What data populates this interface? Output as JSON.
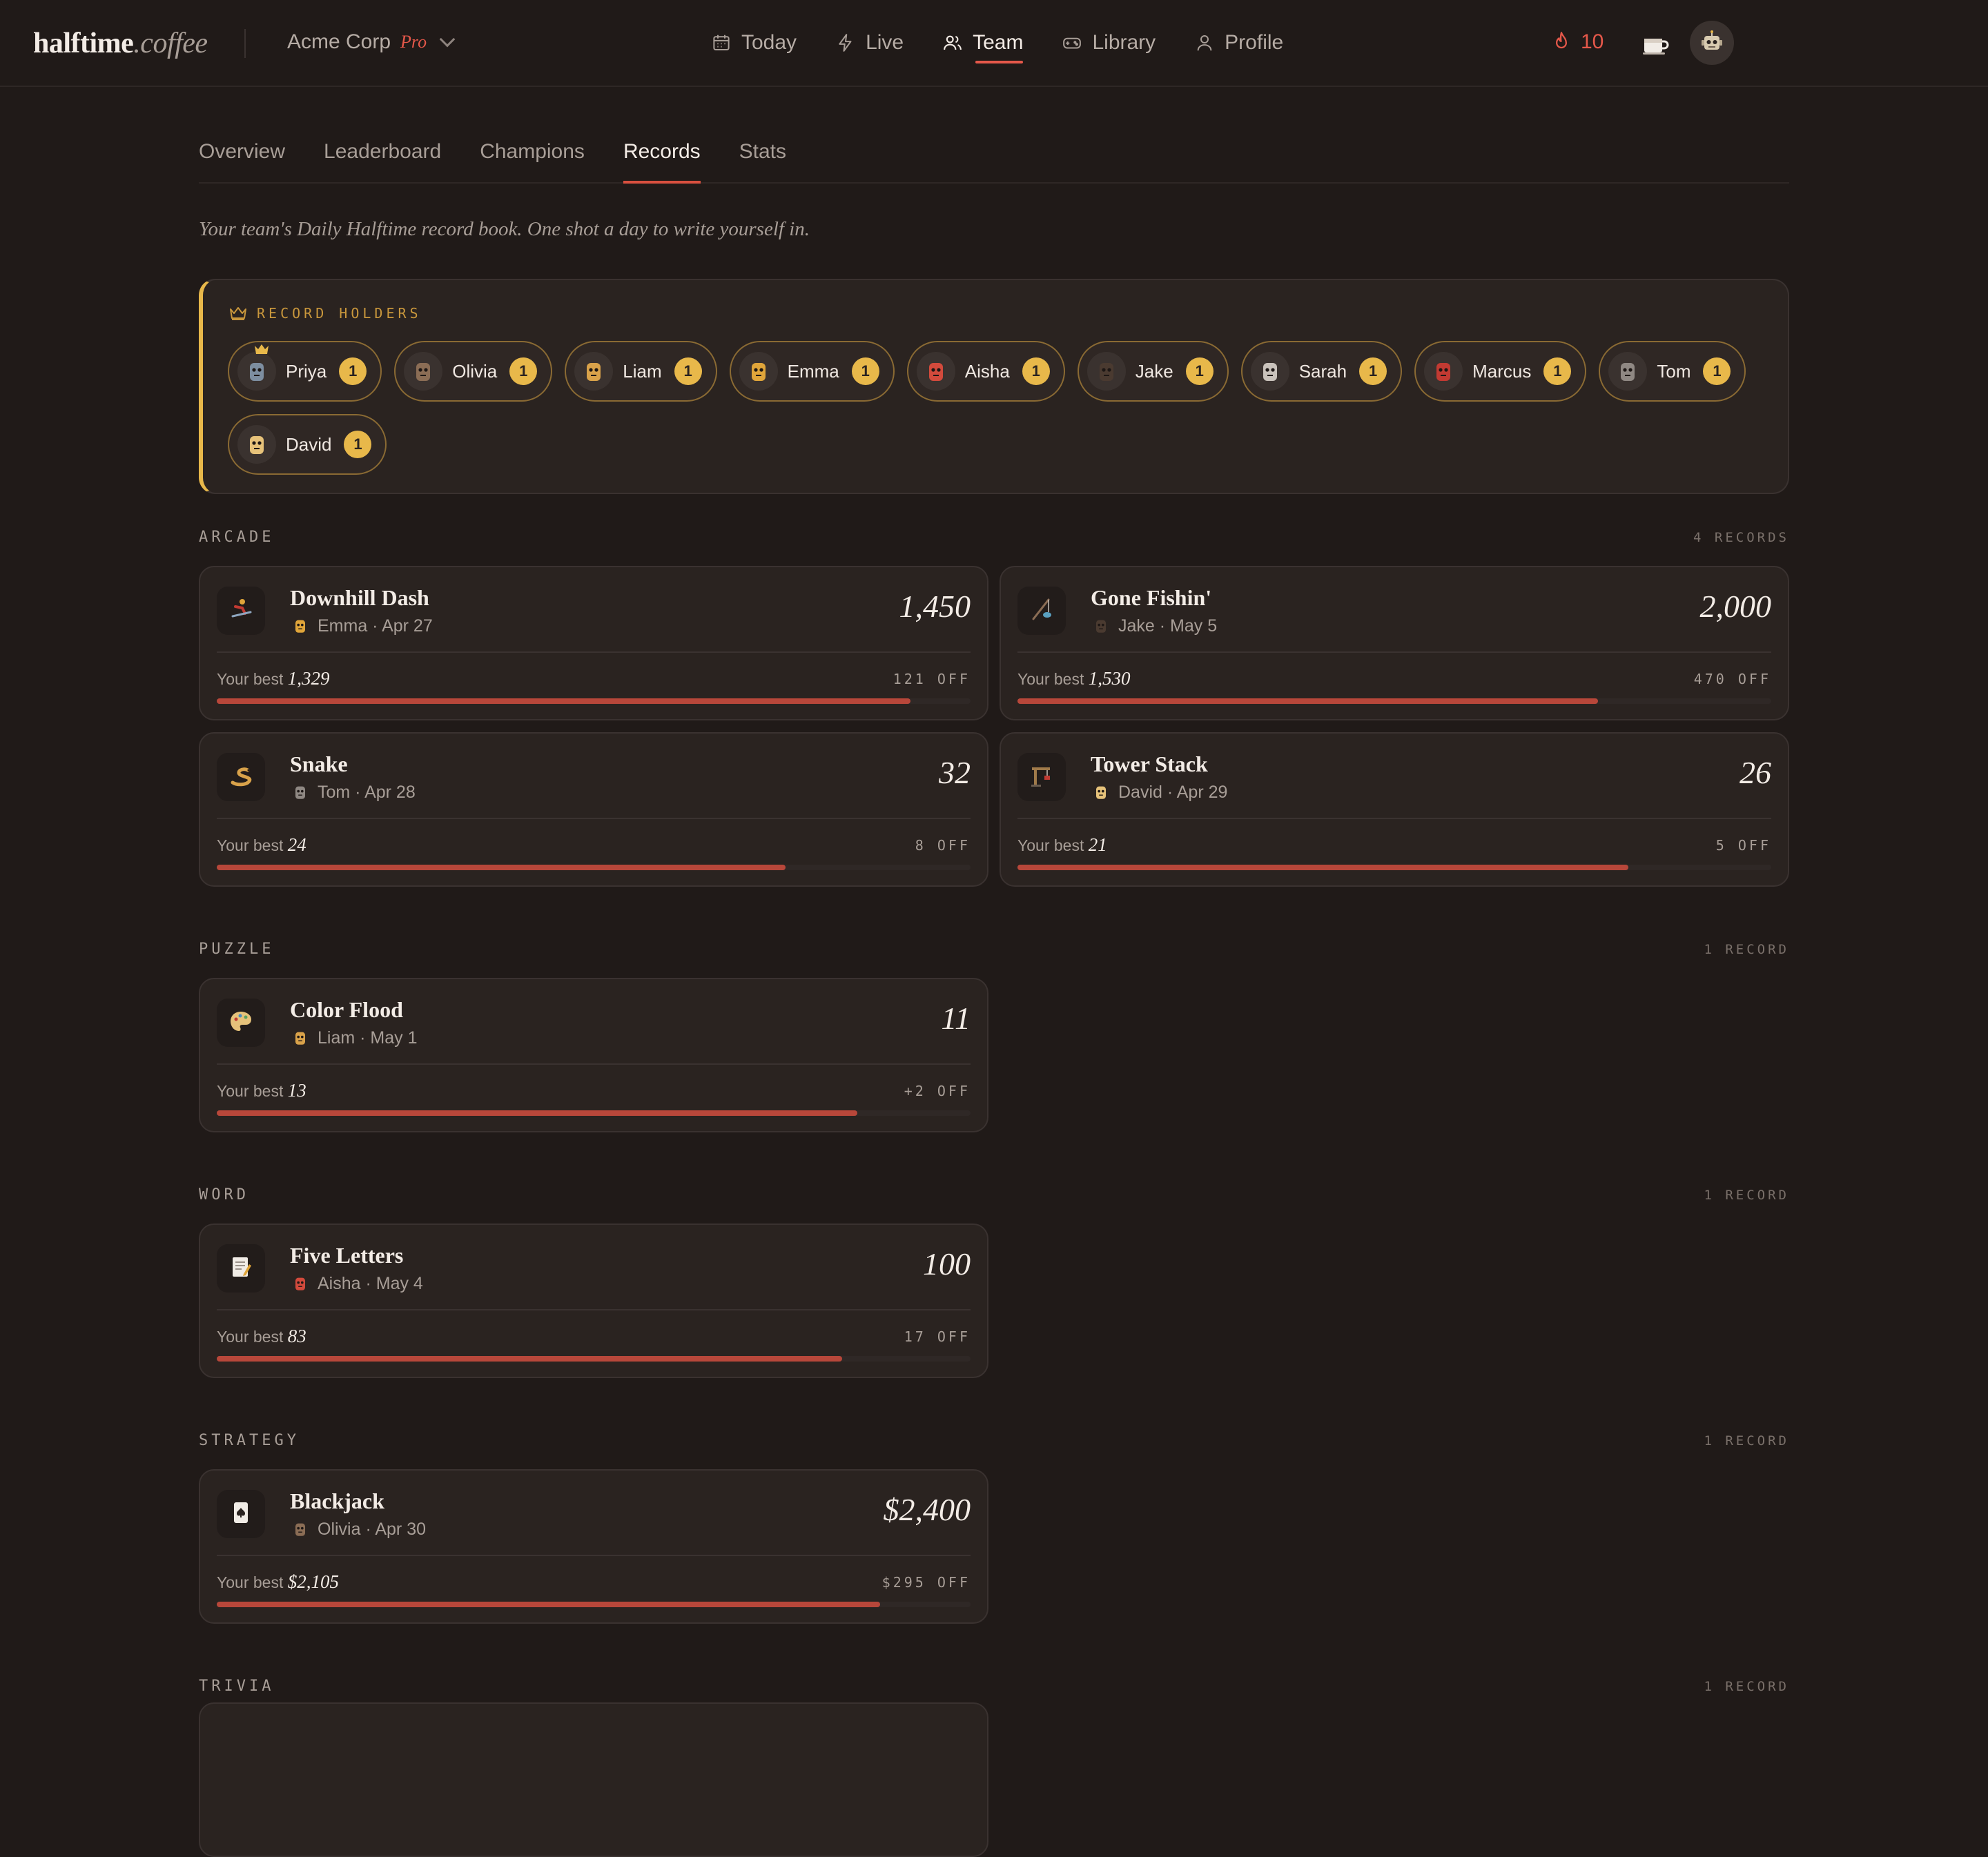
{
  "brand": {
    "bold": "halftime",
    "light": ".coffee"
  },
  "org": {
    "name": "Acme Corp",
    "plan": "Pro"
  },
  "nav": [
    {
      "label": "Today",
      "icon": "calendar-icon"
    },
    {
      "label": "Live",
      "icon": "lightning-icon"
    },
    {
      "label": "Team",
      "icon": "users-icon",
      "active": true
    },
    {
      "label": "Library",
      "icon": "gamepad-icon"
    },
    {
      "label": "Profile",
      "icon": "user-icon"
    }
  ],
  "streak": "10",
  "subtabs": [
    "Overview",
    "Leaderboard",
    "Champions",
    "Records",
    "Stats"
  ],
  "active_subtab": "Records",
  "intro": "Your team's Daily Halftime record book. One shot a day to write yourself in.",
  "holders": {
    "title": "RECORD HOLDERS",
    "people": [
      {
        "name": "Priya",
        "count": "1",
        "color": "#7d8ea0"
      },
      {
        "name": "Olivia",
        "count": "1",
        "color": "#8b6d55"
      },
      {
        "name": "Liam",
        "count": "1",
        "color": "#d9a24a"
      },
      {
        "name": "Emma",
        "count": "1",
        "color": "#e0a53a"
      },
      {
        "name": "Aisha",
        "count": "1",
        "color": "#d24a3c"
      },
      {
        "name": "Jake",
        "count": "1",
        "color": "#4a3a30"
      },
      {
        "name": "Sarah",
        "count": "1",
        "color": "#c9c2bb"
      },
      {
        "name": "Marcus",
        "count": "1",
        "color": "#c23a32"
      },
      {
        "name": "Tom",
        "count": "1",
        "color": "#8f8883"
      },
      {
        "name": "David",
        "count": "1",
        "color": "#e6c27a"
      }
    ]
  },
  "sections": [
    {
      "name": "ARCADE",
      "count": "4 RECORDS",
      "cards": [
        {
          "title": "Downhill Dash",
          "holder": "Emma · Apr 27",
          "score": "1,450",
          "best": "1,329",
          "off": "121 OFF",
          "progress": 0.92,
          "holder_color": "#e0a53a"
        },
        {
          "title": "Gone Fishin'",
          "holder": "Jake · May 5",
          "score": "2,000",
          "best": "1,530",
          "off": "470 OFF",
          "progress": 0.77,
          "holder_color": "#4a3a30"
        },
        {
          "title": "Snake",
          "holder": "Tom · Apr 28",
          "score": "32",
          "best": "24",
          "off": "8 OFF",
          "progress": 0.755,
          "holder_color": "#8f8883"
        },
        {
          "title": "Tower Stack",
          "holder": "David · Apr 29",
          "score": "26",
          "best": "21",
          "off": "5 OFF",
          "progress": 0.81,
          "holder_color": "#e6c27a"
        }
      ]
    },
    {
      "name": "PUZZLE",
      "count": "1 RECORD",
      "cards": [
        {
          "title": "Color Flood",
          "holder": "Liam · May 1",
          "score": "11",
          "best": "13",
          "off": "+2 OFF",
          "progress": 0.85,
          "holder_color": "#d9a24a"
        }
      ]
    },
    {
      "name": "WORD",
      "count": "1 RECORD",
      "cards": [
        {
          "title": "Five Letters",
          "holder": "Aisha · May 4",
          "score": "100",
          "best": "83",
          "off": "17 OFF",
          "progress": 0.83,
          "holder_color": "#d24a3c"
        }
      ]
    },
    {
      "name": "STRATEGY",
      "count": "1 RECORD",
      "cards": [
        {
          "title": "Blackjack",
          "holder": "Olivia · Apr 30",
          "score": "$2,400",
          "best": "$2,105",
          "off": "$295 OFF",
          "progress": 0.88,
          "holder_color": "#8b6d55"
        }
      ]
    },
    {
      "name": "TRIVIA",
      "count": "1 RECORD",
      "cards": []
    }
  ],
  "labels": {
    "your_best": "Your best"
  },
  "colors": {
    "accent": "#e5584a",
    "gold": "#e8b84a",
    "bar": "#b8473a"
  }
}
